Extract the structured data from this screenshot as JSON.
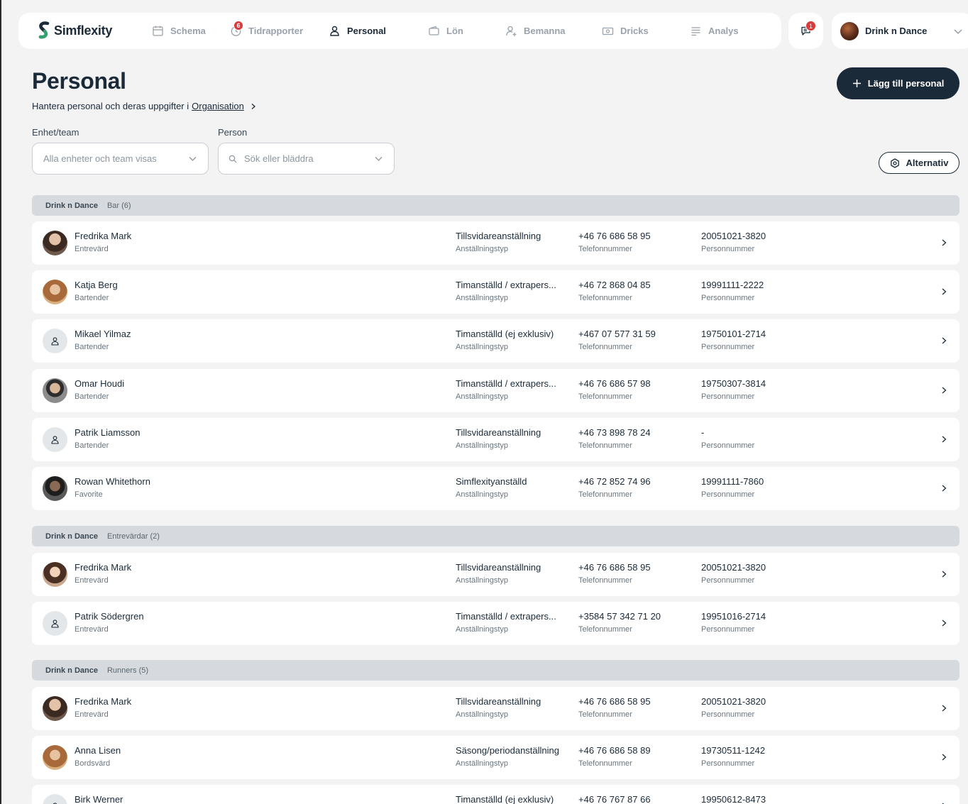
{
  "nav": {
    "logo": "Simflexity",
    "items": [
      {
        "label": "Schema",
        "icon": "calendar-icon"
      },
      {
        "label": "Tidrapporter",
        "icon": "clock-icon",
        "badge": "6"
      },
      {
        "label": "Personal",
        "icon": "person-icon",
        "active": true
      },
      {
        "label": "Lön",
        "icon": "wallet-icon"
      },
      {
        "label": "Bemanna",
        "icon": "person-add-icon"
      },
      {
        "label": "Dricks",
        "icon": "cash-icon"
      },
      {
        "label": "Analys",
        "icon": "lines-icon"
      }
    ],
    "messages_badge": "1",
    "org_name": "Drink n Dance"
  },
  "header": {
    "title": "Personal",
    "subtitle_text": "Hantera personal och deras uppgifter i",
    "subtitle_link": "Organisation",
    "add_button": "Lägg till personal"
  },
  "filters": {
    "unit_label": "Enhet/team",
    "unit_value": "Alla enheter och team visas",
    "person_label": "Person",
    "person_placeholder": "Sök eller bläddra",
    "options_button": "Alternativ"
  },
  "captions": {
    "employment": "Anställningstyp",
    "phone": "Telefonnummer",
    "ssn": "Personnummer"
  },
  "groups": [
    {
      "org": "Drink n Dance",
      "team": "Bar (6)",
      "rows": [
        {
          "name": "Fredrika Mark",
          "role": "Entrevärd",
          "employment": "Tillsvidareanställning",
          "phone": "+46 76 686 58 95",
          "ssn": "20051021-3820",
          "avatar": "photo"
        },
        {
          "name": "Katja Berg",
          "role": "Bartender",
          "employment": "Timanställd / extrapers...",
          "phone": "+46 72 868 04 85",
          "ssn": "19991111-2222",
          "avatar": "photo"
        },
        {
          "name": "Mikael Yilmaz",
          "role": "Bartender",
          "employment": "Timanställd (ej exklusiv)",
          "phone": "+467 07 577 31 59",
          "ssn": "19750101-2714",
          "avatar": "placeholder"
        },
        {
          "name": "Omar Houdi",
          "role": "Bartender",
          "employment": "Timanställd / extrapers...",
          "phone": "+46 76 686 57 98",
          "ssn": "19750307-3814",
          "avatar": "photo"
        },
        {
          "name": "Patrik Liamsson",
          "role": "Bartender",
          "employment": "Tillsvidareanställning",
          "phone": "+46 73 898 78 24",
          "ssn": "-",
          "avatar": "placeholder"
        },
        {
          "name": "Rowan Whitethorn",
          "role": "Favorite",
          "employment": "Simflexityanställd",
          "phone": "+46 72 852 74 96",
          "ssn": "19991111-7860",
          "avatar": "photo"
        }
      ]
    },
    {
      "org": "Drink n Dance",
      "team": "Entrevärdar (2)",
      "rows": [
        {
          "name": "Fredrika Mark",
          "role": "Entrevärd",
          "employment": "Tillsvidareanställning",
          "phone": "+46 76 686 58 95",
          "ssn": "20051021-3820",
          "avatar": "photo"
        },
        {
          "name": "Patrik Södergren",
          "role": "Entrevärd",
          "employment": "Timanställd / extrapers...",
          "phone": "+3584 57 342 71 20",
          "ssn": "19951016-2714",
          "avatar": "placeholder"
        }
      ]
    },
    {
      "org": "Drink n Dance",
      "team": "Runners (5)",
      "rows": [
        {
          "name": "Fredrika Mark",
          "role": "Entrevärd",
          "employment": "Tillsvidareanställning",
          "phone": "+46 76 686 58 95",
          "ssn": "20051021-3820",
          "avatar": "photo"
        },
        {
          "name": "Anna Lisen",
          "role": "Bordsvärd",
          "employment": "Säsong/periodanställning",
          "phone": "+46 76 686 58 89",
          "ssn": "19730511-1242",
          "avatar": "photo"
        },
        {
          "name": "Birk Werner",
          "role": "",
          "employment": "Timanställd (ej exklusiv)",
          "phone": "+46 76 767 87 66",
          "ssn": "19950612-8473",
          "avatar": "placeholder"
        }
      ]
    }
  ],
  "colors": {
    "primary": "#1b2a38",
    "badge": "#d93a3a",
    "background": "#f3f3f4",
    "group_header": "#d6dade"
  }
}
